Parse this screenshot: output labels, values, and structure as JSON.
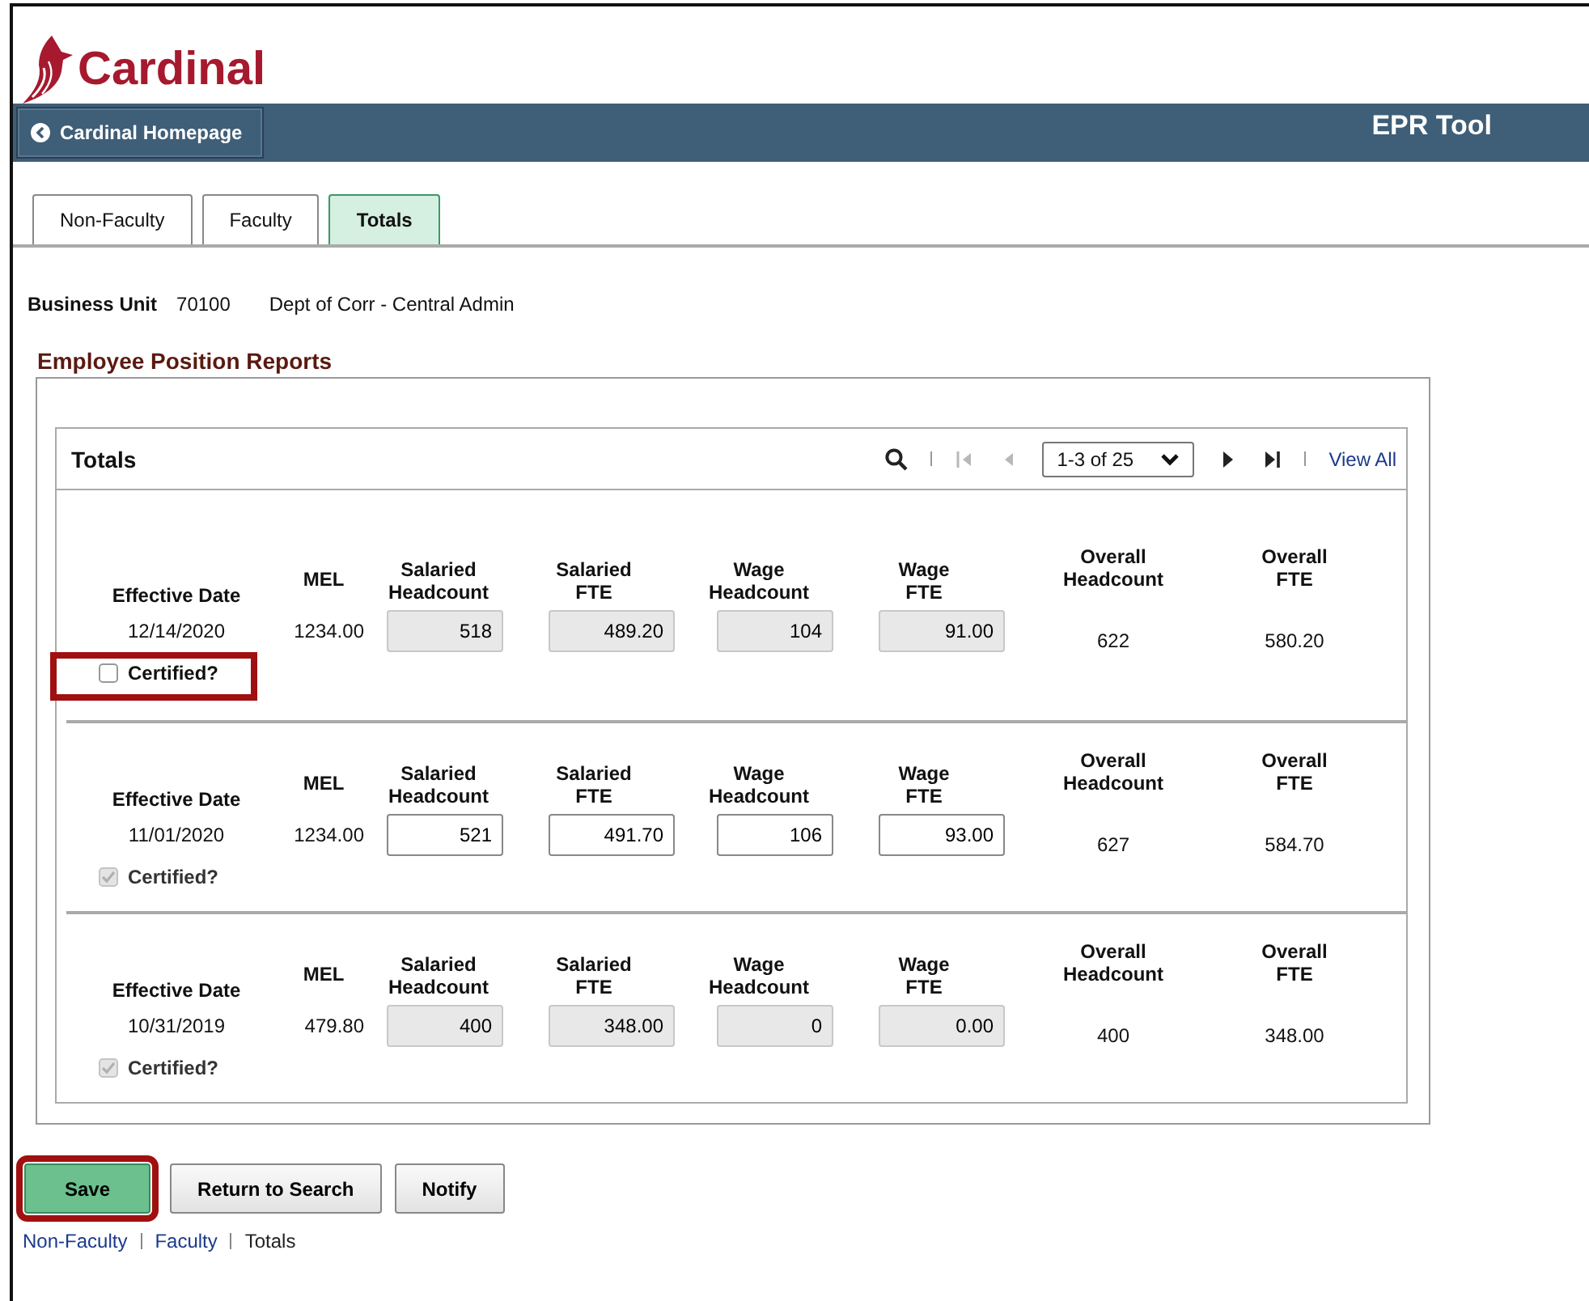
{
  "logo": {
    "text": "Cardinal"
  },
  "header": {
    "back_button": "Cardinal Homepage",
    "title": "EPR Tool"
  },
  "tabs": [
    {
      "label": "Non-Faculty",
      "selected": false
    },
    {
      "label": "Faculty",
      "selected": false
    },
    {
      "label": "Totals",
      "selected": true
    }
  ],
  "business_unit": {
    "label": "Business Unit",
    "code": "70100",
    "description": "Dept of Corr - Central Admin"
  },
  "section_title": "Employee Position Reports",
  "grid": {
    "title": "Totals",
    "pager": {
      "range": "1-3 of 25",
      "view_all": "View All",
      "nav": [
        {
          "kind": "first",
          "disabled": true
        },
        {
          "kind": "prev",
          "disabled": true
        },
        {
          "kind": "next",
          "disabled": false
        },
        {
          "kind": "last",
          "disabled": false
        }
      ]
    },
    "rows": [
      {
        "columns": [
          "Effective Date",
          "MEL",
          "Salaried Headcount",
          "Salaried FTE",
          "Wage Headcount",
          "Wage FTE",
          "Overall Headcount",
          "Overall FTE"
        ],
        "effective_date": "12/14/2020",
        "mel": "1234.00",
        "fields": [
          "518",
          "489.20",
          "104",
          "91.00"
        ],
        "editable": false,
        "overall_headcount": "622",
        "overall_fte": "580.20",
        "certified": {
          "label": "Certified?",
          "checked": false,
          "disabled": false,
          "highlighted": true
        }
      },
      {
        "columns": [
          "Effective Date",
          "MEL",
          "Salaried Headcount",
          "Salaried FTE",
          "Wage Headcount",
          "Wage FTE",
          "Overall Headcount",
          "Overall FTE"
        ],
        "effective_date": "11/01/2020",
        "mel": "1234.00",
        "fields": [
          "521",
          "491.70",
          "106",
          "93.00"
        ],
        "editable": true,
        "overall_headcount": "627",
        "overall_fte": "584.70",
        "certified": {
          "label": "Certified?",
          "checked": true,
          "disabled": true,
          "highlighted": false
        }
      },
      {
        "columns": [
          "Effective Date",
          "MEL",
          "Salaried Headcount",
          "Salaried FTE",
          "Wage Headcount",
          "Wage FTE",
          "Overall Headcount",
          "Overall FTE"
        ],
        "effective_date": "10/31/2019",
        "mel": "479.80",
        "fields": [
          "400",
          "348.00",
          "0",
          "0.00"
        ],
        "editable": false,
        "overall_headcount": "400",
        "overall_fte": "348.00",
        "certified": {
          "label": "Certified?",
          "checked": true,
          "disabled": true,
          "highlighted": false
        }
      }
    ]
  },
  "buttons": [
    {
      "label": "Save",
      "kind": "primary",
      "highlighted": true
    },
    {
      "label": "Return to Search",
      "kind": "secondary",
      "highlighted": false
    },
    {
      "label": "Notify",
      "kind": "secondary",
      "highlighted": false
    }
  ],
  "footer_links": [
    {
      "label": "Non-Faculty",
      "selected": false
    },
    {
      "label": "Faculty",
      "selected": false
    },
    {
      "label": "Totals",
      "selected": true
    }
  ]
}
